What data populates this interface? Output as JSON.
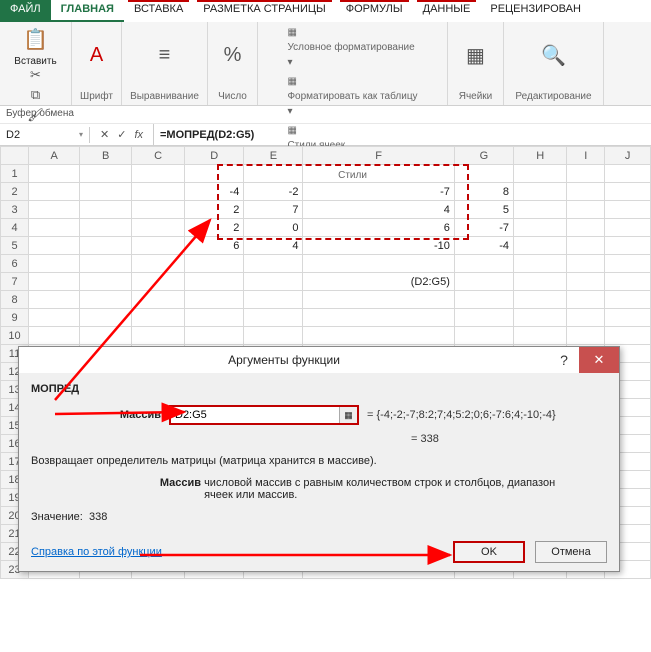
{
  "tabs": {
    "file": "ФАЙЛ",
    "home": "ГЛАВНАЯ",
    "insert": "ВСТАВКА",
    "layout": "РАЗМЕТКА СТРАНИЦЫ",
    "formulas": "ФОРМУЛЫ",
    "data": "ДАННЫЕ",
    "review": "РЕЦЕНЗИРОВАН"
  },
  "ribbon": {
    "paste": "Вставить",
    "font": "Шрифт",
    "align": "Выравнивание",
    "number": "Число",
    "condfmt": "Условное форматирование",
    "astable": "Форматировать как таблицу",
    "cellstyles": "Стили ячеек",
    "styles": "Стили",
    "cells": "Ячейки",
    "editing": "Редактирование",
    "clipboard": "Буфер обмена"
  },
  "formula_bar": {
    "name": "D2",
    "formula": "=МОПРЕД(D2:G5)"
  },
  "columns": [
    "A",
    "B",
    "C",
    "D",
    "E",
    "F",
    "G",
    "H",
    "I",
    "J"
  ],
  "rows": 23,
  "matrix": [
    [
      "-4",
      "-2",
      "-7",
      "8"
    ],
    [
      "2",
      "7",
      "4",
      "5"
    ],
    [
      "2",
      "0",
      "6",
      "-7"
    ],
    [
      "6",
      "4",
      "-10",
      "-4"
    ]
  ],
  "f7": "(D2:G5)",
  "dialog": {
    "title": "Аргументы функции",
    "func": "МОПРЕД",
    "arg_label": "Массив",
    "arg_value": "D2:G5",
    "arg_preview": "{-4;-2;-7;8:2;7;4;5:2;0;6;-7:6;4;-10;-4}",
    "result_eq": "= 338",
    "desc": "Возвращает определитель матрицы (матрица хранится в массиве).",
    "arg_desc_label": "Массив",
    "arg_desc": "числовой массив с равным количеством строк и столбцов, диапазон ячеек или массив.",
    "value_label": "Значение:",
    "value": "338",
    "help": "Справка по этой функции",
    "ok": "OK",
    "cancel": "Отмена"
  }
}
